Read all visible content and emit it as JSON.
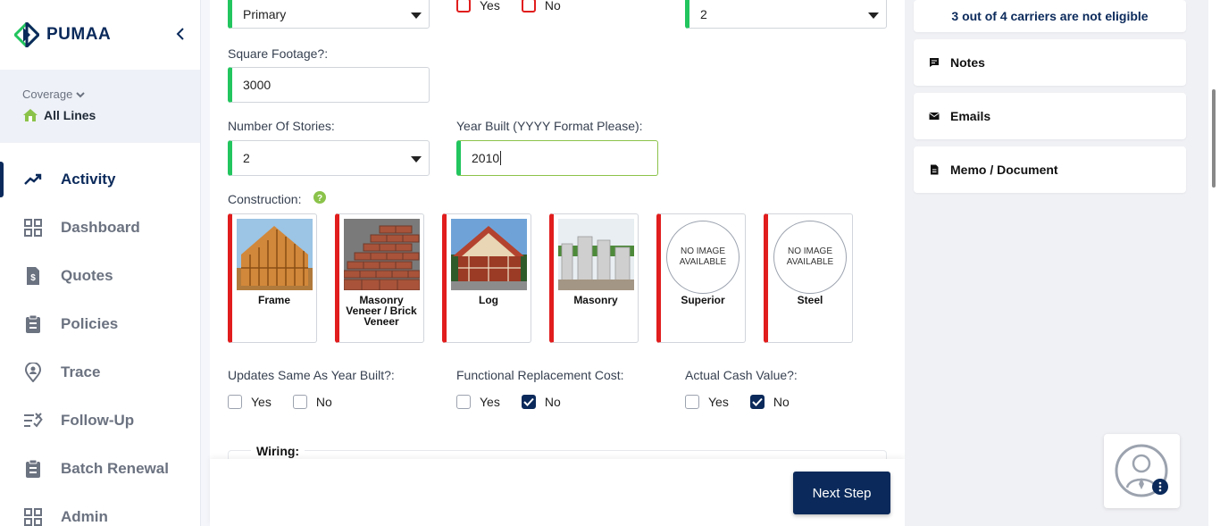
{
  "app": {
    "name": "PUMAA"
  },
  "coverage": {
    "label": "Coverage",
    "value": "All Lines"
  },
  "nav": [
    {
      "label": "Activity",
      "icon": "trend-icon",
      "active": true
    },
    {
      "label": "Dashboard",
      "icon": "grid-icon"
    },
    {
      "label": "Quotes",
      "icon": "dollar-doc-icon"
    },
    {
      "label": "Policies",
      "icon": "clipboard-icon"
    },
    {
      "label": "Trace",
      "icon": "location-person-icon"
    },
    {
      "label": "Follow-Up",
      "icon": "checklist-icon"
    },
    {
      "label": "Batch Renewal",
      "icon": "clipboard-icon"
    },
    {
      "label": "Admin",
      "icon": "grid-icon"
    }
  ],
  "form": {
    "occupancy": {
      "value": "Primary"
    },
    "top_yes": "Yes",
    "top_no": "No",
    "top_right": {
      "value": "2"
    },
    "square_footage": {
      "label": "Square Footage?:",
      "value": "3000"
    },
    "stories": {
      "label": "Number Of Stories:",
      "value": "2"
    },
    "year_built": {
      "label": "Year Built (YYYY Format Please):",
      "value": "2010"
    },
    "construction": {
      "label": "Construction:",
      "options": [
        {
          "name": "Frame",
          "image": "house-frame"
        },
        {
          "name": "Masonry Veneer / Brick Veneer",
          "image": "brick-wall"
        },
        {
          "name": "Log",
          "image": "log-house"
        },
        {
          "name": "Masonry",
          "image": "masonry-blocks"
        },
        {
          "name": "Superior",
          "image": "none"
        },
        {
          "name": "Steel",
          "image": "none"
        }
      ],
      "no_image_text": "NO IMAGE AVAILABLE"
    },
    "updates_same": {
      "label": "Updates Same As Year Built?:",
      "yes": "Yes",
      "no": "No",
      "selected": "none"
    },
    "functional_replacement": {
      "label": "Functional Replacement Cost:",
      "yes": "Yes",
      "no": "No",
      "selected": "No"
    },
    "actual_cash_value": {
      "label": "Actual Cash Value?:",
      "yes": "Yes",
      "no": "No",
      "selected": "No"
    },
    "wiring": {
      "label": "Wiring:"
    }
  },
  "footer": {
    "next_label": "Next Step"
  },
  "right_panel": {
    "eligibility": "3 out of 4 carriers are not eligible",
    "items": [
      {
        "label": "Notes",
        "icon": "note-icon"
      },
      {
        "label": "Emails",
        "icon": "envelope-icon"
      },
      {
        "label": "Memo / Document",
        "icon": "document-icon"
      }
    ]
  },
  "colors": {
    "brand": "#0b2a5b",
    "valid": "#22c55e",
    "invalid": "#e11d1d"
  }
}
